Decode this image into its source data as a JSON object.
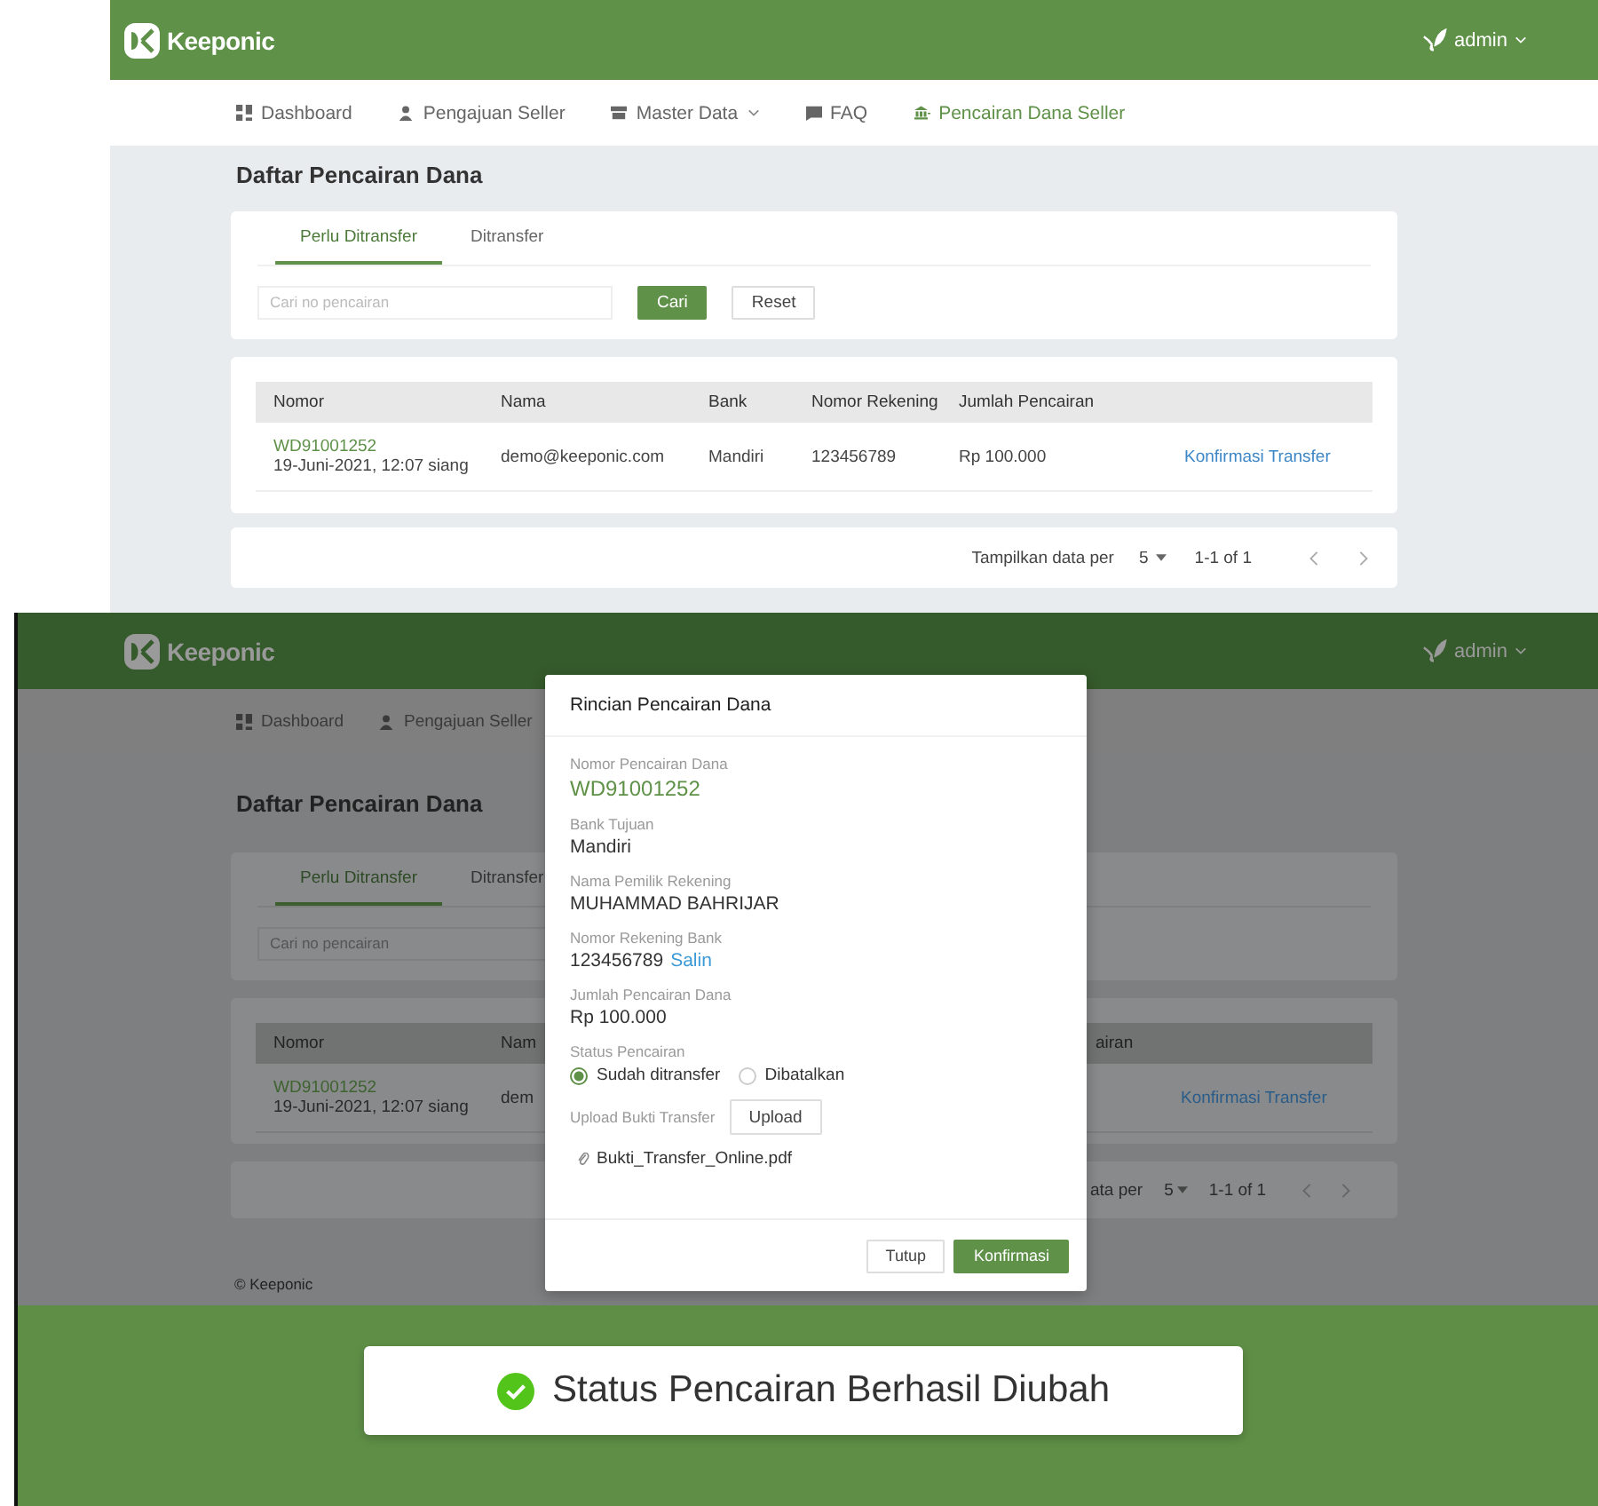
{
  "top": {
    "brand": "Keeponic",
    "user": "admin",
    "nav": [
      {
        "label": "Dashboard",
        "has_menu": false,
        "selected": false
      },
      {
        "label": "Pengajuan Seller",
        "has_menu": false,
        "selected": false
      },
      {
        "label": "Master Data",
        "has_menu": true,
        "selected": false
      },
      {
        "label": "FAQ",
        "has_menu": false,
        "selected": false
      },
      {
        "label": "Pencairan Dana Seller",
        "has_menu": false,
        "selected": true
      }
    ],
    "title": "Daftar Pencairan Dana",
    "tabs": [
      {
        "label": "Perlu Ditransfer",
        "selected": true
      },
      {
        "label": "Ditransfer",
        "selected": false
      }
    ],
    "search": {
      "placeholder": "Cari no pencairan"
    },
    "search_button": "Cari",
    "reset_button": "Reset",
    "table": {
      "columns": [
        "Nomor",
        "Nama",
        "Bank",
        "Nomor Rekening",
        "Jumlah Pencairan"
      ],
      "rows": [
        {
          "number": "WD91001252",
          "date": "19-Juni-2021, 12:07 siang",
          "name": "demo@keeponic.com",
          "bank": "Mandiri",
          "account": "123456789",
          "amount": "Rp 100.000",
          "action": "Konfirmasi Transfer"
        }
      ]
    },
    "pagination": {
      "label": "Tampilkan data per",
      "per_page": "5",
      "range": "1-1 of 1"
    }
  },
  "bottom": {
    "brand": "Keeponic",
    "user": "admin",
    "nav": [
      {
        "label": "Dashboard"
      },
      {
        "label": "Pengajuan Seller"
      }
    ],
    "title": "Daftar Pencairan Dana",
    "tabs": [
      {
        "label": "Perlu Ditransfer",
        "selected": true
      },
      {
        "label": "Ditransfer",
        "selected": false
      }
    ],
    "search": {
      "placeholder": "Cari no pencairan"
    },
    "table": {
      "columns": [
        "Nomor",
        "Nam",
        "airan"
      ],
      "rows": [
        {
          "number": "WD91001252",
          "date": "19-Juni-2021, 12:07 siang",
          "name": "dem",
          "action": "Konfirmasi Transfer"
        }
      ]
    },
    "pagination": {
      "label": "ata per",
      "per_page": "5",
      "range": "1-1 of 1"
    },
    "footer": "© Keeponic"
  },
  "modal": {
    "title": "Rincian Pencairan Dana",
    "fields": [
      {
        "label": "Nomor Pencairan Dana",
        "value": "WD91001252",
        "kind": "id"
      },
      {
        "label": "Bank Tujuan",
        "value": "Mandiri",
        "kind": "text"
      },
      {
        "label": "Nama Pemilik Rekening",
        "value": "MUHAMMAD BAHRIJAR",
        "kind": "text"
      },
      {
        "label": "Nomor Rekening Bank",
        "value": "123456789",
        "kind": "copy",
        "action": "Salin"
      },
      {
        "label": "Jumlah Pencairan Dana",
        "value": "Rp 100.000",
        "kind": "text"
      }
    ],
    "status": {
      "label": "Status Pencairan",
      "options": [
        {
          "label": "Sudah ditransfer",
          "selected": true
        },
        {
          "label": "Dibatalkan",
          "selected": false
        }
      ]
    },
    "upload": {
      "label": "Upload Bukti Transfer",
      "button": "Upload",
      "file": "Bukti_Transfer_Online.pdf"
    },
    "buttons": [
      "Tutup",
      "Konfirmasi"
    ]
  },
  "toast": {
    "message": "Status Pencairan Berhasil Diubah"
  }
}
